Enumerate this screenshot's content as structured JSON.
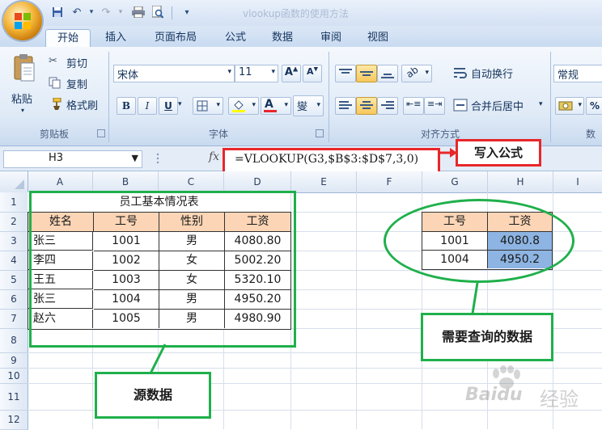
{
  "title_bar": {
    "window_title": "vlookup函数的使用方法"
  },
  "tabs": [
    "开始",
    "插入",
    "页面布局",
    "公式",
    "数据",
    "审阅",
    "视图"
  ],
  "ribbon": {
    "clipboard": {
      "paste": "粘贴",
      "cut": "剪切",
      "copy": "复制",
      "format_painter": "格式刷",
      "group_label": "剪贴板"
    },
    "font": {
      "font_name": "宋体",
      "font_size": "11",
      "bold": "B",
      "italic": "I",
      "underline": "U",
      "font_color_glyph": "A",
      "phonetic": "燮",
      "group_label": "字体"
    },
    "alignment": {
      "wrap_text": "自动换行",
      "merge_center": "合并后居中",
      "group_label": "对齐方式"
    },
    "number": {
      "format": "常规",
      "percent": "%",
      "group_label": "数"
    }
  },
  "formula_bar": {
    "name_box": "H3",
    "fx": "fx",
    "formula": "=VLOOKUP(G3,$B$3:$D$7,3,0)",
    "callout": "写入公式"
  },
  "columns": [
    "A",
    "B",
    "C",
    "D",
    "E",
    "F",
    "G",
    "H",
    "I"
  ],
  "rows": [
    "1",
    "2",
    "3",
    "4",
    "5",
    "6",
    "7",
    "8",
    "9",
    "10",
    "11",
    "12"
  ],
  "source_table": {
    "title": "员工基本情况表",
    "headers": [
      "姓名",
      "工号",
      "性别",
      "工资"
    ],
    "rows": [
      [
        "张三",
        "1001",
        "男",
        "4080.80"
      ],
      [
        "李四",
        "1002",
        "女",
        "5002.20"
      ],
      [
        "王五",
        "1003",
        "女",
        "5320.10"
      ],
      [
        "张三",
        "1004",
        "男",
        "4950.20"
      ],
      [
        "赵六",
        "1005",
        "男",
        "4980.90"
      ]
    ],
    "callout": "源数据"
  },
  "lookup_table": {
    "headers": [
      "工号",
      "工资"
    ],
    "rows": [
      [
        "1001",
        "4080.8"
      ],
      [
        "1004",
        "4950.2"
      ]
    ],
    "callout": "需要查询的数据"
  },
  "watermark": {
    "brand": "Baidu",
    "suffix": "经验"
  },
  "colors": {
    "header_fill": "#fbd5b5",
    "result_fill": "#8db4e2",
    "callout_green": "#1fb04b",
    "callout_red": "#e8262a"
  }
}
